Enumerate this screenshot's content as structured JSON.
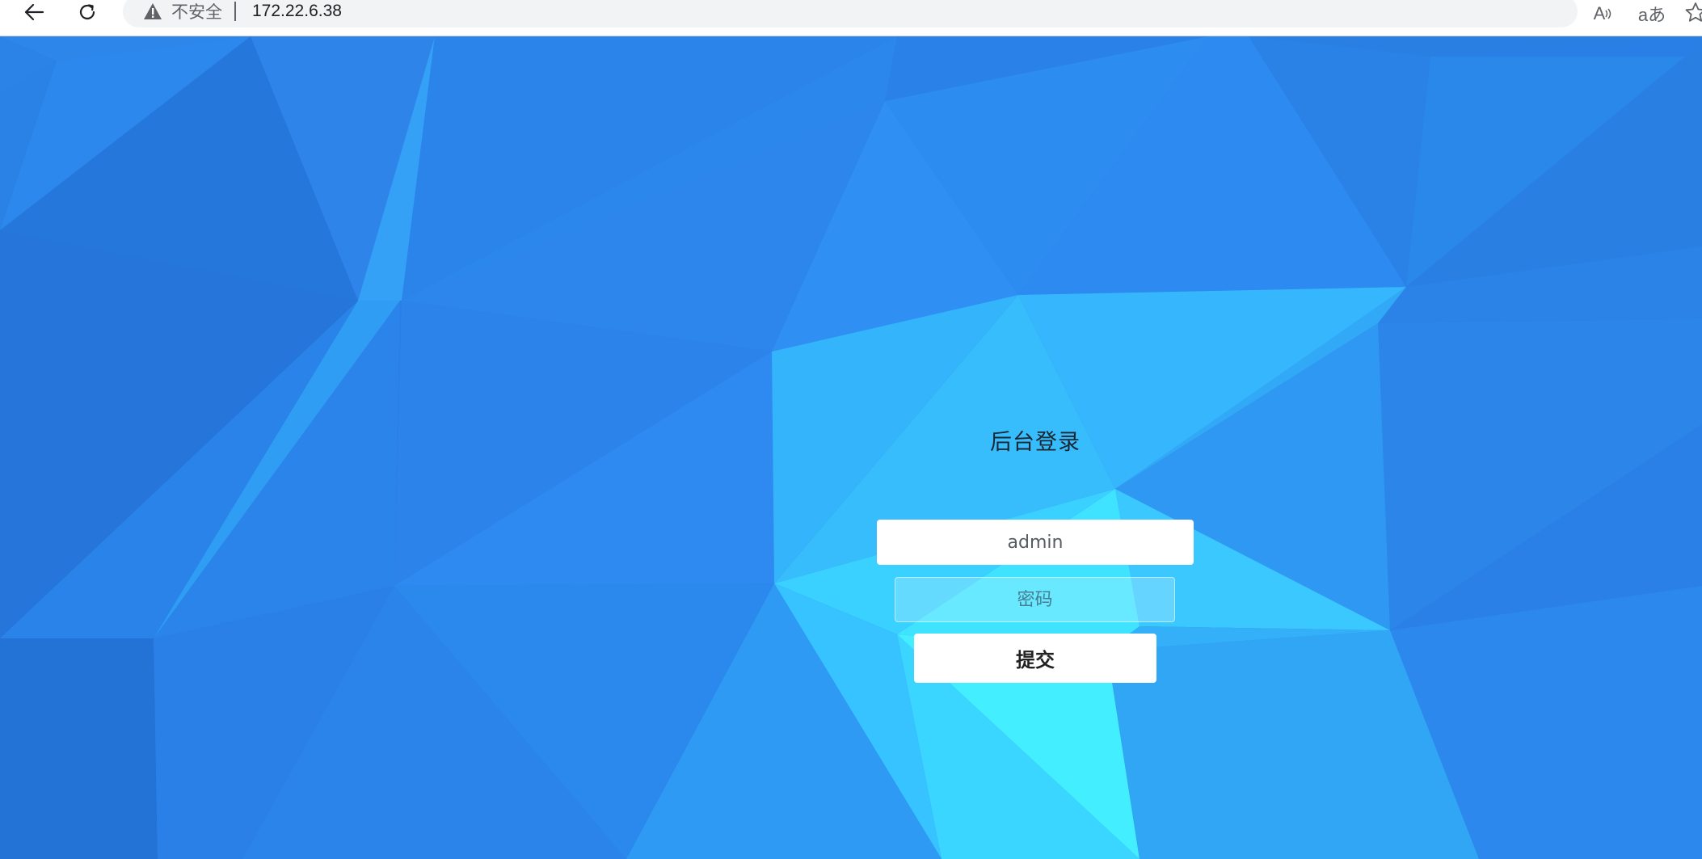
{
  "browser": {
    "security_label": "不安全",
    "url": "172.22.6.38",
    "read_aloud_label": "A",
    "translate_label": "aあ",
    "icons": {
      "back": "arrow-left-icon",
      "reload": "reload-icon",
      "security": "warning-triangle-icon",
      "favorite": "star-icon"
    }
  },
  "login": {
    "title": "后台登录",
    "username_value": "admin",
    "password_placeholder": "密码",
    "submit_label": "提交"
  },
  "colors": {
    "background_base": "#2a7fe6",
    "background_light": "#3de8ff",
    "panel_white": "#ffffff",
    "warning_icon": "#5f6368"
  }
}
